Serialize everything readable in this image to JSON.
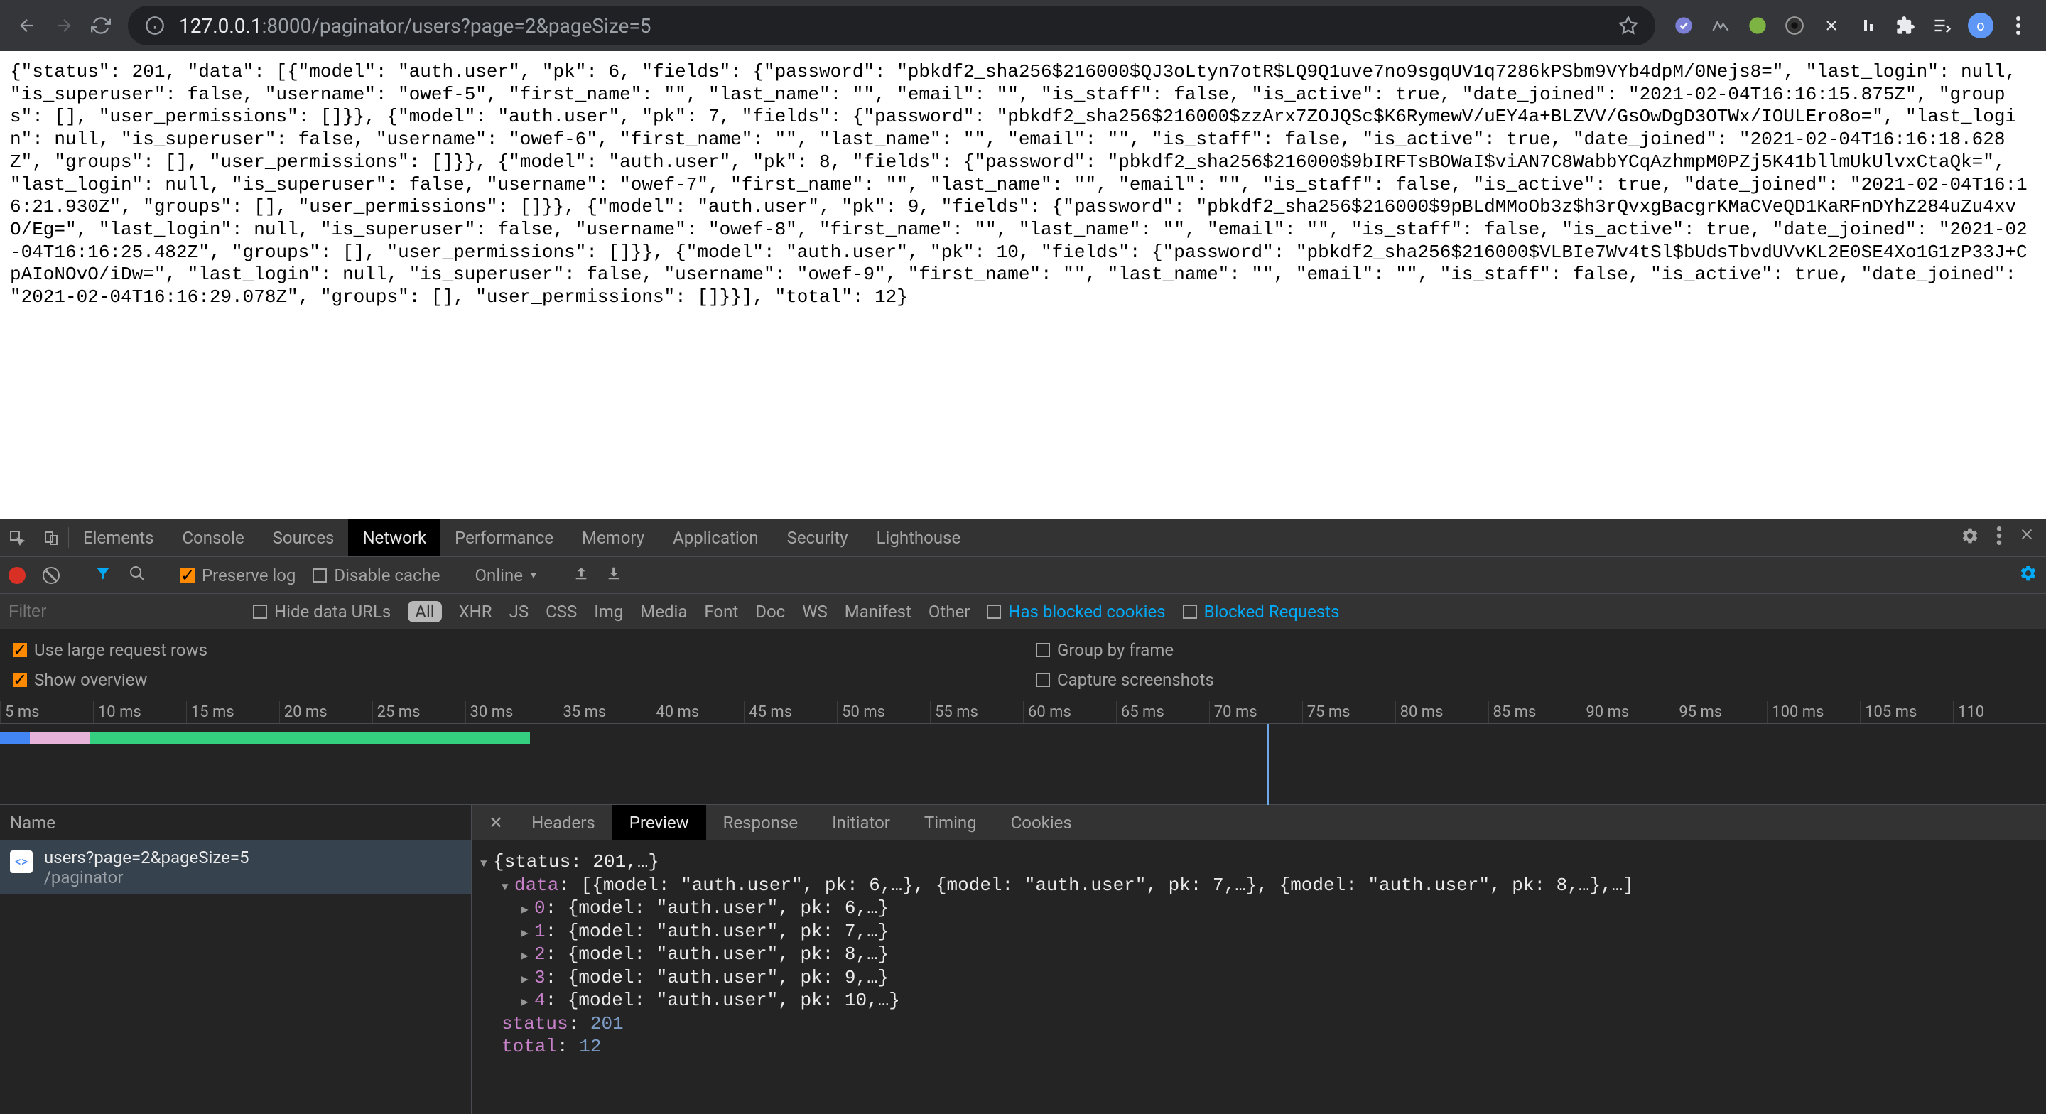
{
  "browser": {
    "url_host": "127.0.0.1",
    "url_port": ":8000",
    "url_path": "/paginator/users?page=2&pageSize=5",
    "avatar_initial": "o"
  },
  "page_json": "{\"status\": 201, \"data\": [{\"model\": \"auth.user\", \"pk\": 6, \"fields\": {\"password\": \"pbkdf2_sha256$216000$QJ3oLtyn7otR$LQ9Q1uve7no9sgqUV1q7286kPSbm9VYb4dpM/0Nejs8=\", \"last_login\": null, \"is_superuser\": false, \"username\": \"owef-5\", \"first_name\": \"\", \"last_name\": \"\", \"email\": \"\", \"is_staff\": false, \"is_active\": true, \"date_joined\": \"2021-02-04T16:16:15.875Z\", \"groups\": [], \"user_permissions\": []}}, {\"model\": \"auth.user\", \"pk\": 7, \"fields\": {\"password\": \"pbkdf2_sha256$216000$zzArx7ZOJQSc$K6RymewV/uEY4a+BLZVV/GsOwDgD3OTWx/IOULEro8o=\", \"last_login\": null, \"is_superuser\": false, \"username\": \"owef-6\", \"first_name\": \"\", \"last_name\": \"\", \"email\": \"\", \"is_staff\": false, \"is_active\": true, \"date_joined\": \"2021-02-04T16:16:18.628Z\", \"groups\": [], \"user_permissions\": []}}, {\"model\": \"auth.user\", \"pk\": 8, \"fields\": {\"password\": \"pbkdf2_sha256$216000$9bIRFTsBOWaI$viAN7C8WabbYCqAzhmpM0PZj5K41bllmUkUlvxCtaQk=\", \"last_login\": null, \"is_superuser\": false, \"username\": \"owef-7\", \"first_name\": \"\", \"last_name\": \"\", \"email\": \"\", \"is_staff\": false, \"is_active\": true, \"date_joined\": \"2021-02-04T16:16:21.930Z\", \"groups\": [], \"user_permissions\": []}}, {\"model\": \"auth.user\", \"pk\": 9, \"fields\": {\"password\": \"pbkdf2_sha256$216000$9pBLdMMoOb3z$h3rQvxgBacgrKMaCVeQD1KaRFnDYhZ284uZu4xvO/Eg=\", \"last_login\": null, \"is_superuser\": false, \"username\": \"owef-8\", \"first_name\": \"\", \"last_name\": \"\", \"email\": \"\", \"is_staff\": false, \"is_active\": true, \"date_joined\": \"2021-02-04T16:16:25.482Z\", \"groups\": [], \"user_permissions\": []}}, {\"model\": \"auth.user\", \"pk\": 10, \"fields\": {\"password\": \"pbkdf2_sha256$216000$VLBIe7Wv4tSl$bUdsTbvdUVvKL2E0SE4Xo1G1zP33J+CpAIoNOvO/iDw=\", \"last_login\": null, \"is_superuser\": false, \"username\": \"owef-9\", \"first_name\": \"\", \"last_name\": \"\", \"email\": \"\", \"is_staff\": false, \"is_active\": true, \"date_joined\": \"2021-02-04T16:16:29.078Z\", \"groups\": [], \"user_permissions\": []}}], \"total\": 12}",
  "devtools": {
    "tabs": [
      "Elements",
      "Console",
      "Sources",
      "Network",
      "Performance",
      "Memory",
      "Application",
      "Security",
      "Lighthouse"
    ],
    "active_tab": "Network",
    "toolbar": {
      "preserve_log": "Preserve log",
      "disable_cache": "Disable cache",
      "throttle": "Online"
    },
    "filter": {
      "placeholder": "Filter",
      "hide_data_urls": "Hide data URLs",
      "types": [
        "All",
        "XHR",
        "JS",
        "CSS",
        "Img",
        "Media",
        "Font",
        "Doc",
        "WS",
        "Manifest",
        "Other"
      ],
      "active_type": "All",
      "has_blocked_cookies": "Has blocked cookies",
      "blocked_requests": "Blocked Requests"
    },
    "options": {
      "use_large_rows": "Use large request rows",
      "show_overview": "Show overview",
      "group_by_frame": "Group by frame",
      "capture_screenshots": "Capture screenshots"
    },
    "timeline_ticks": [
      "5 ms",
      "10 ms",
      "15 ms",
      "20 ms",
      "25 ms",
      "30 ms",
      "35 ms",
      "40 ms",
      "45 ms",
      "50 ms",
      "55 ms",
      "60 ms",
      "65 ms",
      "70 ms",
      "75 ms",
      "80 ms",
      "85 ms",
      "90 ms",
      "95 ms",
      "100 ms",
      "105 ms",
      "110"
    ],
    "request_list": {
      "header": "Name",
      "items": [
        {
          "name": "users?page=2&pageSize=5",
          "path": "/paginator"
        }
      ]
    },
    "detail": {
      "tabs": [
        "Headers",
        "Preview",
        "Response",
        "Initiator",
        "Timing",
        "Cookies"
      ],
      "active": "Preview",
      "preview_root": "{status: 201,…}",
      "preview_data_line": "[{model: \"auth.user\", pk: 6,…}, {model: \"auth.user\", pk: 7,…}, {model: \"auth.user\", pk: 8,…},…]",
      "preview_items": [
        {
          "idx": "0",
          "summary": "{model: \"auth.user\", pk: 6,…}"
        },
        {
          "idx": "1",
          "summary": "{model: \"auth.user\", pk: 7,…}"
        },
        {
          "idx": "2",
          "summary": "{model: \"auth.user\", pk: 8,…}"
        },
        {
          "idx": "3",
          "summary": "{model: \"auth.user\", pk: 9,…}"
        },
        {
          "idx": "4",
          "summary": "{model: \"auth.user\", pk: 10,…}"
        }
      ],
      "status_key": "status",
      "status_val": "201",
      "total_key": "total",
      "total_val": "12",
      "data_key": "data"
    }
  }
}
